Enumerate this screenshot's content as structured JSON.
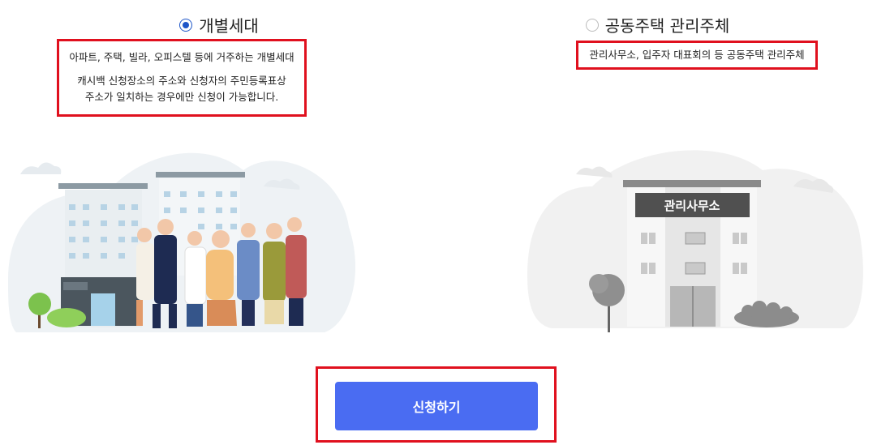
{
  "options": {
    "individual": {
      "label": "개별세대",
      "selected": true,
      "desc_line1": "아파트, 주택, 빌라, 오피스텔 등에 거주하는 개별세대",
      "desc_line2": "캐시백 신청장소의 주소와 신청자의 주민등록표상",
      "desc_line3": "주소가 일치하는 경우에만 신청이 가능합니다."
    },
    "complex": {
      "label": "공동주택 관리주체",
      "selected": false,
      "desc_line1": "관리사무소, 입주자 대표회의 등 공동주택 관리주체",
      "office_sign": "관리사무소"
    }
  },
  "submit": {
    "label": "신청하기"
  },
  "colors": {
    "accent": "#4a6cf2",
    "radio_selected": "#1e56c8",
    "highlight_border": "#e0101e"
  }
}
